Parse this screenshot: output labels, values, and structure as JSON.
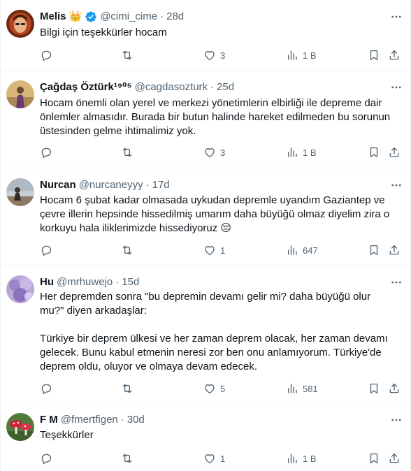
{
  "tweets": [
    {
      "name": "Melis",
      "badge": "👑",
      "verified": true,
      "handle": "@cimi_cime",
      "time": "28d",
      "text": "Bilgi için teşekkürler hocam",
      "replies": "",
      "retweets": "",
      "likes": "3",
      "views": "1 B"
    },
    {
      "name": "Çağdaş Öztürk¹⁹⁰⁵",
      "handle": "@cagdasozturk",
      "time": "25d",
      "text": "Hocam önemli olan yerel ve merkezi yönetimlerin elbirliği ile depreme dair\nönlemler almasıdır. Burada bir butun halinde hareket edilmeden bu sorunun\nüstesinden gelme ihtimalimiz yok.",
      "replies": "",
      "retweets": "",
      "likes": "3",
      "views": "1 B"
    },
    {
      "name": "Nurcan",
      "handle": "@nurcaneyyy",
      "time": "17d",
      "text": "Hocam 6 şubat kadar olmasada uykudan depremle uyandım Gaziantep ve\nçevre illerin hepsinde hissedilmiş umarım daha büyüğü olmaz diyelim zira o\nkorkuyu hala iliklerimizde hissediyoruz 😔",
      "replies": "",
      "retweets": "",
      "likes": "1",
      "views": "647"
    },
    {
      "name": "Hu",
      "handle": "@mrhuwejo",
      "time": "15d",
      "text": "Her depremden sonra \"bu depremin devamı gelir mi? daha büyüğü olur\nmu?\" diyen arkadaşlar:\n\nTürkiye bir deprem ülkesi ve her zaman deprem olacak, her zaman devamı\ngelecek. Bunu kabul etmenin neresi zor ben onu anlamıyorum. Türkiye'de\ndeprem oldu, oluyor ve olmaya devam edecek.",
      "replies": "",
      "retweets": "",
      "likes": "5",
      "views": "581"
    },
    {
      "name": "F M",
      "handle": "@fmertfigen",
      "time": "30d",
      "text": "Teşekkürler",
      "replies": "",
      "retweets": "",
      "likes": "1",
      "views": "1 B"
    }
  ],
  "separator": "·",
  "colors": {
    "text": "#0f1419",
    "secondary": "#536471",
    "verified": "#1d9bf0",
    "divider": "#eff3f4"
  },
  "icons": [
    "reply-icon",
    "retweet-icon",
    "like-icon",
    "views-icon",
    "bookmark-icon",
    "share-icon",
    "more-icon",
    "verified-icon"
  ]
}
